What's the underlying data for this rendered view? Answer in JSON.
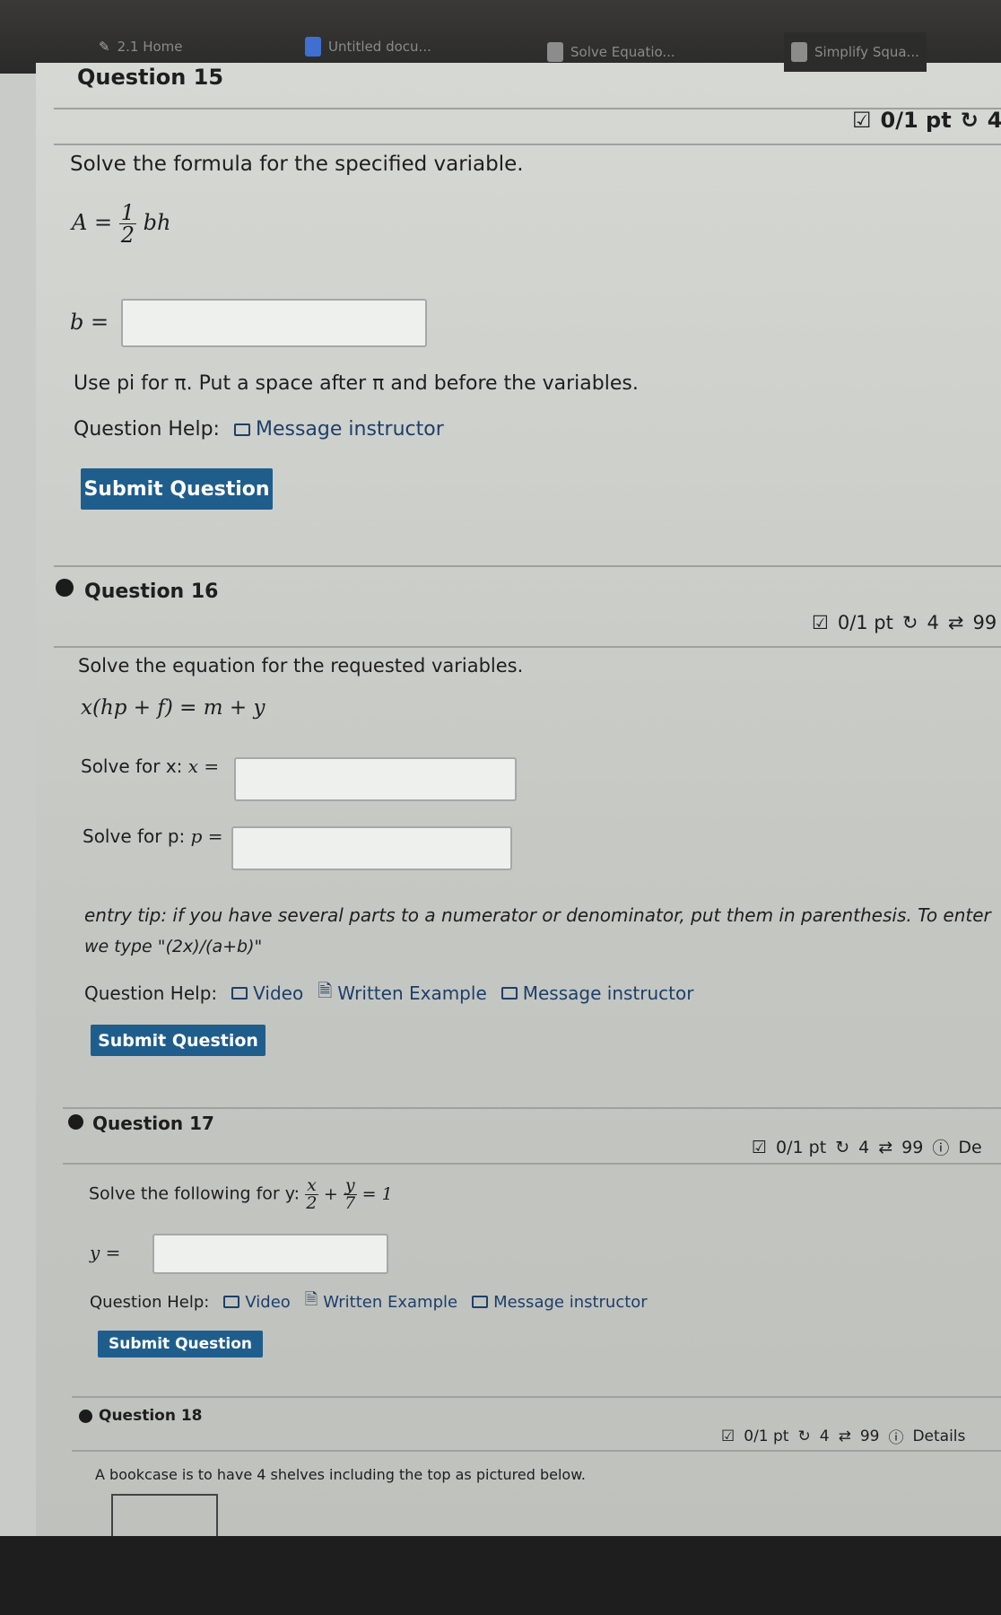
{
  "tabs": [
    {
      "label": "2.1 Home",
      "icon": "pencil-icon"
    },
    {
      "label": "Untitled docu...",
      "icon": "docs-icon"
    },
    {
      "label": "Solve Equatio...",
      "icon": "m-icon"
    },
    {
      "label": "Simplify Squa...",
      "icon": "m-icon"
    }
  ],
  "q15": {
    "title": "Question 15",
    "score": "0/1 pt",
    "retries": "4",
    "prompt": "Solve the formula for the specified variable.",
    "formula_lhs": "A =",
    "frac_num": "1",
    "frac_den": "2",
    "formula_rhs": "bh",
    "answer_label": "b =",
    "answer_value": "",
    "note": "Use pi for π. Put a space after π and before the variables.",
    "help_label": "Question Help:",
    "message": "Message instructor",
    "submit": "Submit Question"
  },
  "q16": {
    "title": "Question 16",
    "score": "0/1 pt",
    "retries": "4",
    "attempts": "99",
    "prompt": "Solve the equation for the requested variables.",
    "equation": "x(hp + f) = m + y",
    "x_label": "Solve for x:",
    "x_var": "x =",
    "x_value": "",
    "p_label": "Solve for p:",
    "p_var": "p =",
    "p_value": "",
    "tip1": "entry tip: if you have several parts to a numerator or denominator, put them in parenthesis. To enter",
    "tip2": "we type \"(2x)/(a+b)\"",
    "help_label": "Question Help:",
    "video": "Video",
    "example": "Written Example",
    "message": "Message instructor",
    "submit": "Submit Question"
  },
  "q17": {
    "title": "Question 17",
    "score": "0/1 pt",
    "retries": "4",
    "attempts": "99",
    "details": "De",
    "prompt": "Solve the following for y:",
    "f1n": "x",
    "f1d": "2",
    "plus": "+",
    "f2n": "y",
    "f2d": "7",
    "eq": "= 1",
    "answer_label": "y =",
    "answer_value": "",
    "help_label": "Question Help:",
    "video": "Video",
    "example": "Written Example",
    "message": "Message instructor",
    "submit": "Submit Question"
  },
  "q18": {
    "title": "Question 18",
    "score": "0/1 pt",
    "retries": "4",
    "attempts": "99",
    "details": "Details",
    "prompt": "A bookcase is to have 4 shelves including the top as pictured below."
  },
  "colors": {
    "button": "#1f5e8c",
    "link": "#1d3f6a"
  }
}
